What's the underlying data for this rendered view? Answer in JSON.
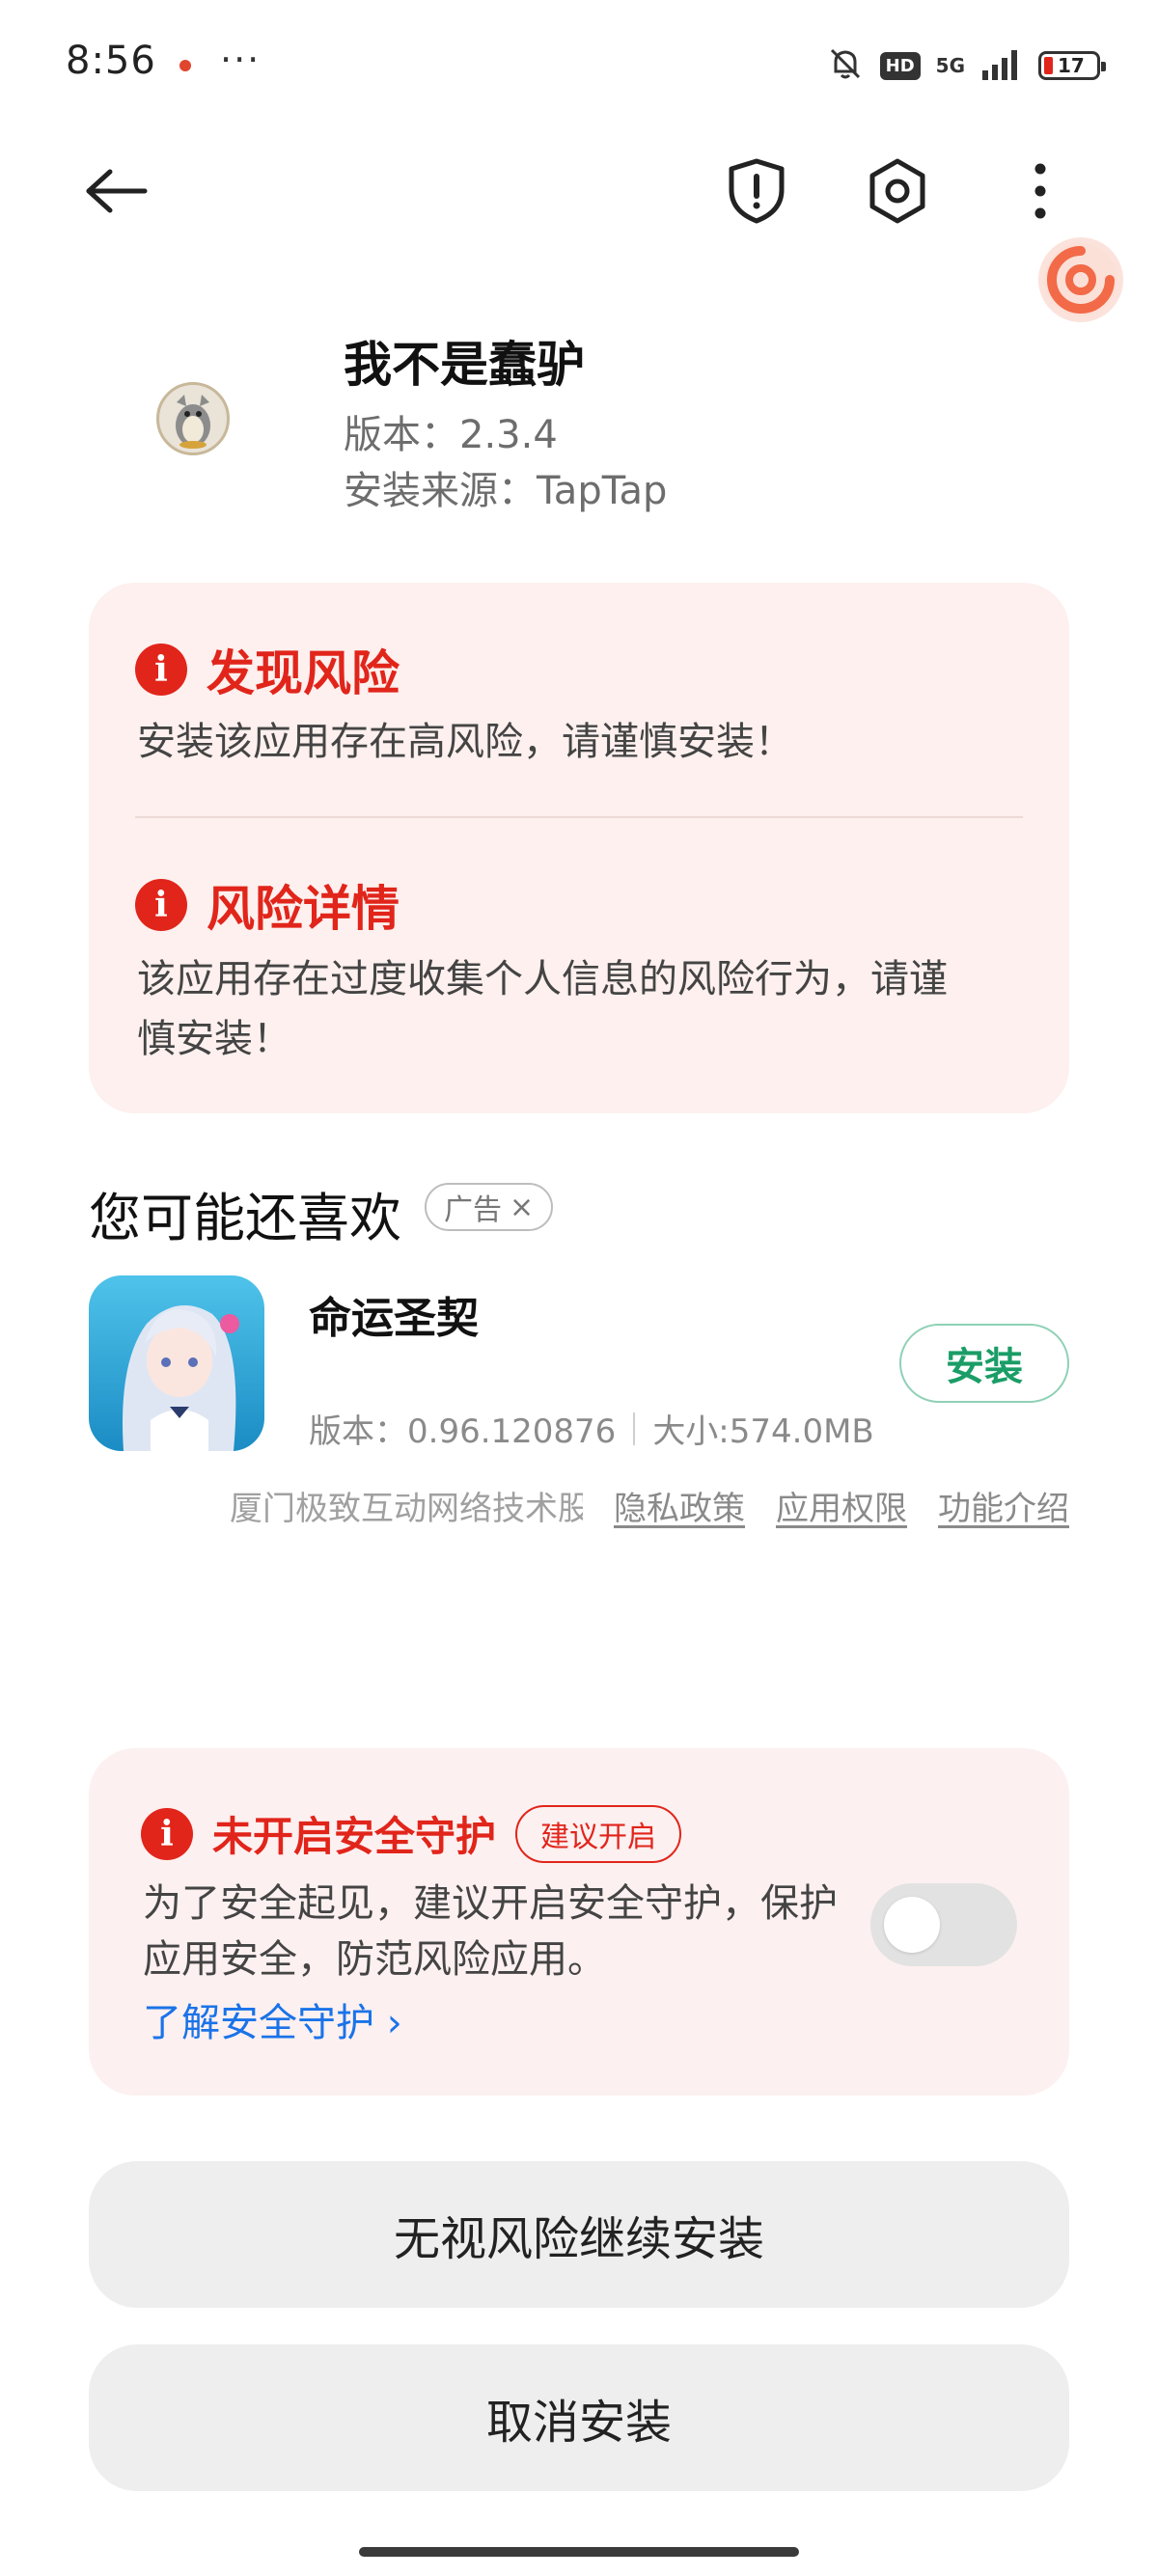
{
  "status_bar": {
    "time": "8:56",
    "more": "···",
    "hd": "HD",
    "network": "5G",
    "battery": "17"
  },
  "nav": {
    "back_icon": "arrow-left-icon",
    "shield_icon": "shield-alert-icon",
    "settings_icon": "hexagon-gear-icon",
    "more_icon": "more-vertical-icon"
  },
  "app": {
    "name": "我不是蠢驴",
    "version": "版本：2.3.4",
    "source": "安装来源：TapTap"
  },
  "risk": {
    "found_title": "发现风险",
    "found_desc": "安装该应用存在高风险，请谨慎安装！",
    "detail_title": "风险详情",
    "detail_desc_line1": "该应用存在过度收集个人信息的风险行为，请谨",
    "detail_desc_line2": "慎安装！"
  },
  "recommend": {
    "title": "您可能还喜欢",
    "ad_label": "广告",
    "ad_close": "×",
    "app_name": "命运圣契",
    "version": "版本：0.96.120876",
    "size": "大小:574.0MB",
    "install_label": "安装",
    "developer": "厦门极致互动网络技术股",
    "privacy": "隐私政策",
    "permissions": "应用权限",
    "features": "功能介绍"
  },
  "security": {
    "title": "未开启安全守护",
    "badge": "建议开启",
    "desc": "为了安全起见，建议开启安全守护，保护应用安全，防范风险应用。",
    "link": "了解安全守护",
    "link_arrow": "›",
    "toggle_on": false
  },
  "actions": {
    "ignore_install": "无视风险继续安装",
    "cancel_install": "取消安装"
  },
  "colors": {
    "danger": "#e1251b",
    "install_green": "#1a9d66",
    "link_blue": "#1a73e8",
    "risk_bg": "#fdf0ee"
  }
}
